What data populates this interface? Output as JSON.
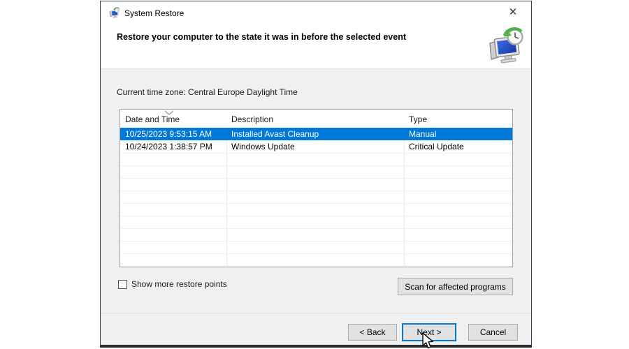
{
  "window": {
    "title": "System Restore",
    "close_glyph": "✕"
  },
  "header": {
    "title": "Restore your computer to the state it was in before the selected event"
  },
  "body": {
    "timezone_label": "Current time zone: Central Europe Daylight Time"
  },
  "table": {
    "columns": [
      "Date and Time",
      "Description",
      "Type"
    ],
    "sort_column": "Date and Time",
    "rows": [
      {
        "date": "10/25/2023 9:53:15 AM",
        "description": "Installed Avast Cleanup",
        "type": "Manual",
        "selected": true
      },
      {
        "date": "10/24/2023 1:38:57 PM",
        "description": "Windows Update",
        "type": "Critical Update",
        "selected": false
      }
    ]
  },
  "controls": {
    "show_more_label": "Show more restore points",
    "show_more_checked": false,
    "scan_button_label": "Scan for affected programs"
  },
  "footer": {
    "back_label": "< Back",
    "next_label": "Next >",
    "cancel_label": "Cancel"
  },
  "colors": {
    "selection_blue": "#0078d7",
    "focus_border": "#0078d7",
    "body_gray": "#f0f0f0",
    "button_gray": "#e1e1e1"
  }
}
